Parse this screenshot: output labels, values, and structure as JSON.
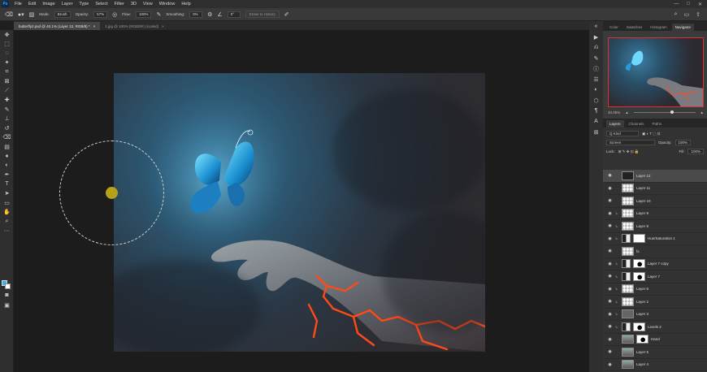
{
  "app": {
    "logo": "Ps"
  },
  "menu": [
    "File",
    "Edit",
    "Image",
    "Layer",
    "Type",
    "Select",
    "Filter",
    "3D",
    "View",
    "Window",
    "Help"
  ],
  "window_controls": [
    "—",
    "□",
    "✕"
  ],
  "options": {
    "mode_label": "Mode:",
    "mode_value": "Brush",
    "opacity_label": "Opacity:",
    "opacity_value": "57%",
    "flow_label": "Flow:",
    "flow_value": "100%",
    "smoothing_label": "Smoothing:",
    "smoothing_value": "0%",
    "angle_value": "0°",
    "erase_history": "Erase to History"
  },
  "tabs": [
    {
      "label": "butterfly2.psd @ 40.1% (Layer 12, RGB/8) *",
      "close": "×"
    },
    {
      "label": "1.jpg @ 100% (RGB/8#) (scaled)",
      "close": "×"
    }
  ],
  "panels": {
    "top_tabs": [
      "Color",
      "Swatches",
      "Histogram",
      "Navigator"
    ],
    "zoom": "40.05%",
    "layer_tabs": [
      "Layers",
      "Channels",
      "Paths"
    ],
    "kind_label": "Q Kind",
    "blend_mode": "Screen",
    "opacity_label": "Opacity:",
    "opacity_value": "100%",
    "lock_label": "Lock:",
    "fill_label": "Fill:",
    "fill_value": "100%"
  },
  "layers": [
    {
      "name": "Layer 12",
      "thumb": "dark",
      "selected": true,
      "clipped": false
    },
    {
      "name": "Layer 11",
      "thumb": "checker",
      "clipped": false
    },
    {
      "name": "Layer 10",
      "thumb": "checker",
      "clipped": false
    },
    {
      "name": "Layer 9",
      "thumb": "checker",
      "clipped": true
    },
    {
      "name": "Layer 8",
      "thumb": "checker",
      "clipped": true
    },
    {
      "name": "Hue/Saturation 1",
      "thumb": "adjustment",
      "mask": "white",
      "clipped": true
    },
    {
      "name": "fx.",
      "thumb": "checker",
      "clipped": false
    },
    {
      "name": "Layer 7 copy",
      "thumb": "adjustment",
      "mask": "hand",
      "clipped": true
    },
    {
      "name": "Layer 7",
      "thumb": "adjustment",
      "mask": "hand",
      "clipped": true
    },
    {
      "name": "Layer 6",
      "thumb": "checker",
      "clipped": true
    },
    {
      "name": "Layer 2",
      "thumb": "checker",
      "clipped": true
    },
    {
      "name": "Layer 3",
      "thumb": "grey",
      "clipped": true
    },
    {
      "name": "Levels 2",
      "thumb": "adjustment",
      "mask": "hand",
      "clipped": true
    },
    {
      "name": "Hand",
      "thumb": "photo",
      "mask": "hand",
      "clipped": false
    },
    {
      "name": "Layer 5",
      "thumb": "photo",
      "clipped": false
    },
    {
      "name": "Layer 4",
      "thumb": "photo",
      "clipped": false
    }
  ]
}
